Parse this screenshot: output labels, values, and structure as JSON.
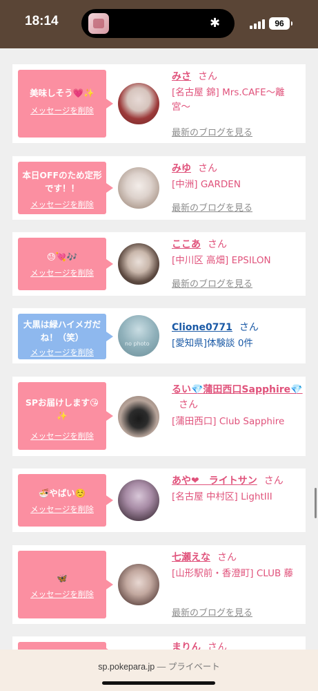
{
  "status": {
    "time": "18:14",
    "battery": "96"
  },
  "cards": [
    {
      "msg": "美味しそう💗✨",
      "delete": "メッセージを削除",
      "name": "みさ",
      "san": "さん",
      "shop": "[名古屋 錦] Mrs.CAFE〜離宮〜",
      "blog": "最新のブログを見る"
    },
    {
      "msg": "本日OFFのため定形です！！",
      "delete": "メッセージを削除",
      "name": "みゆ",
      "san": "さん",
      "shop": "[中洲] GARDEN",
      "blog": "最新のブログを見る"
    },
    {
      "msg": "😓💘🎶",
      "delete": "メッセージを削除",
      "name": "ここあ",
      "san": "さん",
      "shop": "[中川区 高畑] EPSILON",
      "blog": "最新のブログを見る"
    },
    {
      "msg": "大黒は緑ハイメガだね！（笑）",
      "delete": "メッセージを削除",
      "name": "Clione0771",
      "san": "さん",
      "shop": "[愛知県]体験談 0件",
      "avatar_text": "no photo"
    },
    {
      "msg": "SPお届けします😘✨",
      "delete": "メッセージを削除",
      "name": "るい💎蒲田西口Sapphire💎",
      "san": "さん",
      "shop": "[蒲田西口] Club Sapphire"
    },
    {
      "msg": "🍜やばい☺️",
      "delete": "メッセージを削除",
      "name": "あや❤︎　ライトサン",
      "san": "さん",
      "shop": "[名古屋 中村区] LightIII"
    },
    {
      "msg": "🦋",
      "delete": "メッセージを削除",
      "name": "七瀬えな",
      "san": "さん",
      "shop": "[山形駅前・香澄町] CLUB 藤",
      "blog": "最新のブログを見る"
    },
    {
      "name": "まりん",
      "san": "さん"
    }
  ],
  "browser": {
    "url": "sp.pokepara.jp",
    "separator": " — ",
    "mode": "プライベート"
  }
}
